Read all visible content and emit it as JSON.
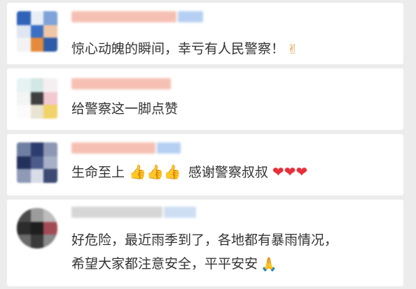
{
  "comments": [
    {
      "text": "惊心动魄的瞬间，幸亏有人民警察！",
      "emoji": "✌",
      "emoji_name": "victory-hand"
    },
    {
      "text": "给警察这一脚点赞"
    },
    {
      "text_before": "生命至上",
      "thumbs": "👍👍👍",
      "text_after": "感谢警察叔叔",
      "hearts": "❤❤❤"
    },
    {
      "line1": "好危险，最近雨季到了，各地都有暴雨情况，",
      "line2": "希望大家都注意安全，平平安安",
      "emoji": "🙏",
      "emoji_name": "folded-hands"
    }
  ],
  "colors": {
    "background": "#ececec",
    "card": "#ffffff",
    "text": "#333333",
    "heart": "#e8303a",
    "name_blur_pink": "#f4b6a6",
    "name_blur_blue": "#a9c8f0"
  }
}
